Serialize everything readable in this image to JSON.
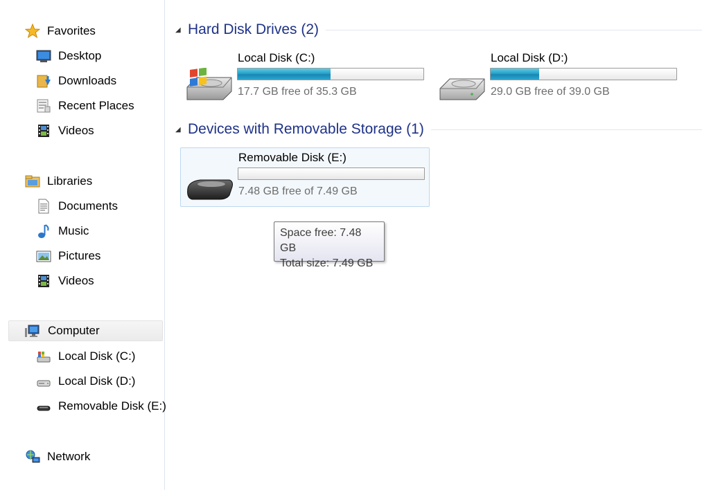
{
  "nav": {
    "favorites": {
      "label": "Favorites",
      "items": [
        "Desktop",
        "Downloads",
        "Recent Places",
        "Videos"
      ]
    },
    "libraries": {
      "label": "Libraries",
      "items": [
        "Documents",
        "Music",
        "Pictures",
        "Videos"
      ]
    },
    "computer": {
      "label": "Computer",
      "items": [
        "Local Disk (C:)",
        "Local Disk (D:)",
        "Removable Disk (E:)"
      ]
    },
    "network": {
      "label": "Network"
    }
  },
  "groups": {
    "hard_disks": {
      "title": "Hard Disk Drives (2)",
      "drives": [
        {
          "name": "Local Disk (C:)",
          "free_text": "17.7 GB free of 35.3 GB",
          "used_fraction": 0.5
        },
        {
          "name": "Local Disk (D:)",
          "free_text": "29.0 GB free of 39.0 GB",
          "used_fraction": 0.26
        }
      ]
    },
    "removable": {
      "title": "Devices with Removable Storage (1)",
      "drives": [
        {
          "name": "Removable Disk (E:)",
          "free_text": "7.48 GB free of 7.49 GB",
          "used_fraction": 0.0
        }
      ]
    }
  },
  "tooltip": {
    "line1": "Space free: 7.48 GB",
    "line2": "Total size: 7.49 GB"
  },
  "colors": {
    "header_blue": "#1e3287",
    "bar_blue": "#27a2c9",
    "selection_border": "#bcd8ef"
  },
  "icons": {
    "favorites": "star-icon",
    "desktop": "desktop-icon",
    "downloads": "downloads-folder-icon",
    "recent_places": "recent-places-icon",
    "videos": "film-icon",
    "libraries": "libraries-icon",
    "documents": "document-icon",
    "music": "music-note-icon",
    "pictures": "picture-icon",
    "computer": "computer-icon",
    "network": "network-icon"
  }
}
